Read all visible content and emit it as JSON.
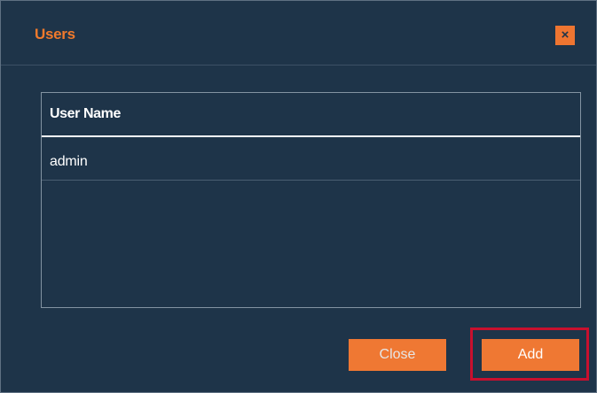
{
  "dialog": {
    "title": "Users",
    "close_icon": "close-icon",
    "accent_color": "#f07a2c",
    "background_color": "#1e3449"
  },
  "table": {
    "columns": [
      "User Name"
    ],
    "rows": [
      [
        "admin"
      ]
    ]
  },
  "buttons": {
    "close_label": "Close",
    "add_label": "Add"
  },
  "highlight": {
    "target": "add-button",
    "color": "#c8102e"
  }
}
